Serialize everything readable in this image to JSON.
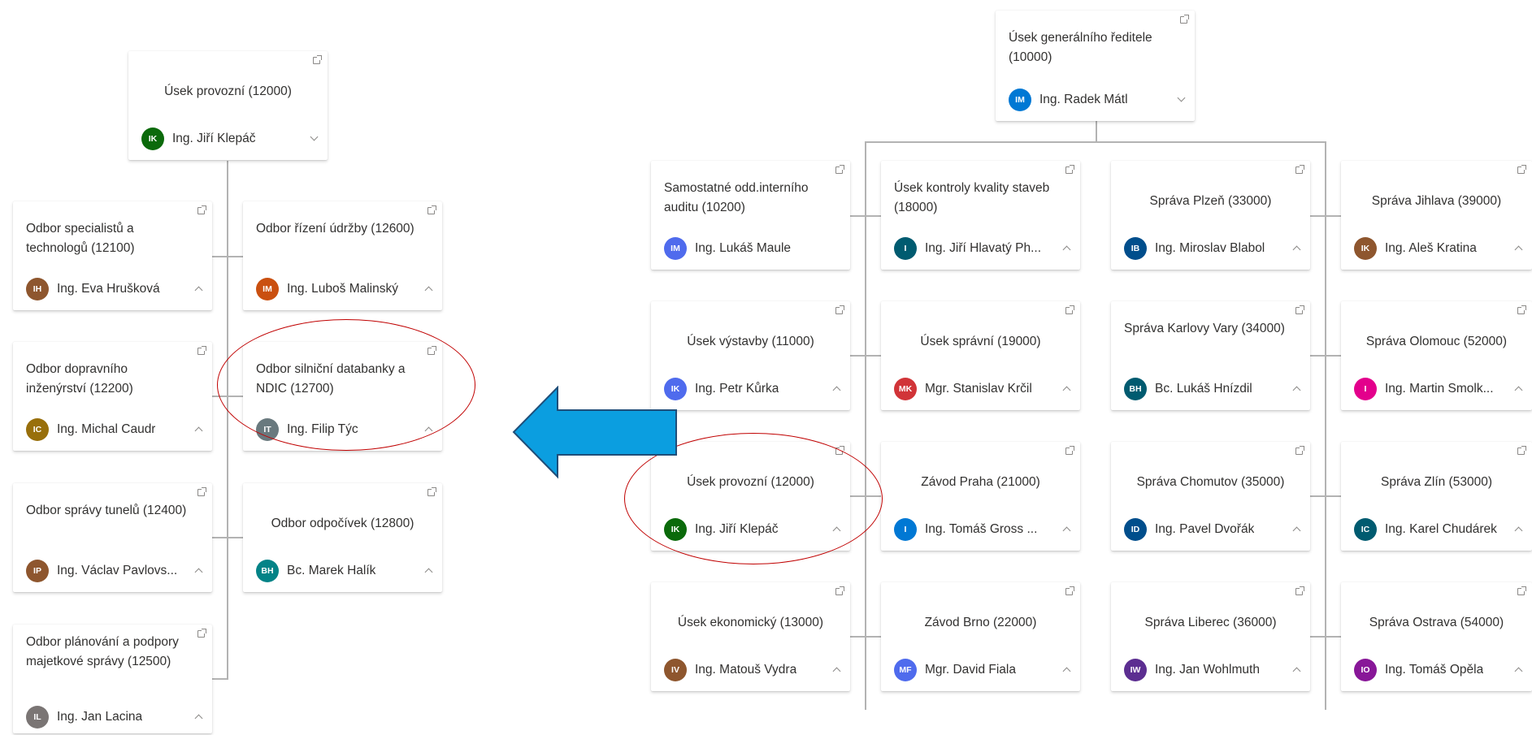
{
  "colors": {
    "connector": "#b3b3b3",
    "highlight_ellipse": "#c00000",
    "arrow_fill": "#0b9ee0",
    "arrow_stroke": "#1f4e79"
  },
  "left_tree": {
    "root": {
      "title": "Úsek provozní (12000)",
      "person": {
        "initials": "IK",
        "name": "Ing. Jiří Klepáč",
        "color": "#0b6a0b"
      },
      "chevron": "down"
    },
    "nodes": [
      {
        "title": "Odbor specialistů a technologů (12100)",
        "person": {
          "initials": "IH",
          "name": "Ing. Eva Hrušková",
          "color": "#8e562e"
        },
        "chevron": "up"
      },
      {
        "title": "Odbor řízení údržby (12600)",
        "person": {
          "initials": "IM",
          "name": "Ing. Luboš Malinský",
          "color": "#ca5010"
        },
        "chevron": "up"
      },
      {
        "title": "Odbor dopravního inženýrství (12200)",
        "person": {
          "initials": "IC",
          "name": "Ing. Michal Caudr",
          "color": "#986f0b"
        },
        "chevron": "up"
      },
      {
        "title": "Odbor silniční databanky a NDIC (12700)",
        "person": {
          "initials": "IT",
          "name": "Ing. Filip Týc",
          "color": "#69797e"
        },
        "chevron": "up"
      },
      {
        "title": "Odbor správy tunelů (12400)",
        "person": {
          "initials": "IP",
          "name": "Ing. Václav Pavlovs...",
          "color": "#8e562e"
        },
        "chevron": "up"
      },
      {
        "title": "Odbor odpočívek (12800)",
        "person": {
          "initials": "BH",
          "name": "Bc. Marek Halík",
          "color": "#038387"
        },
        "chevron": "up"
      },
      {
        "title": "Odbor plánování a podpory majetkové správy (12500)",
        "person": {
          "initials": "IL",
          "name": "Ing. Jan Lacina",
          "color": "#7a7574"
        },
        "chevron": "up"
      }
    ]
  },
  "right_tree": {
    "root": {
      "title": "Úsek generálního ředitele (10000)",
      "person": {
        "initials": "IM",
        "name": "Ing. Radek Mátl",
        "color": "#0078d4"
      },
      "chevron": "down"
    },
    "nodes": [
      {
        "title": "Samostatné odd.interního auditu (10200)",
        "person": {
          "initials": "IM",
          "name": "Ing. Lukáš Maule",
          "color": "#4f6bed"
        },
        "chevron": "none"
      },
      {
        "title": "Úsek kontroly kvality staveb (18000)",
        "person": {
          "initials": "I",
          "name": "Ing. Jiří Hlavatý Ph...",
          "color": "#005b70"
        },
        "chevron": "up"
      },
      {
        "title": "Správa Plzeň (33000)",
        "person": {
          "initials": "IB",
          "name": "Ing. Miroslav Blabol",
          "color": "#004e8c"
        },
        "chevron": "up"
      },
      {
        "title": "Správa Jihlava (39000)",
        "person": {
          "initials": "IK",
          "name": "Ing. Aleš Kratina",
          "color": "#8e562e"
        },
        "chevron": "up"
      },
      {
        "title": "Úsek výstavby (11000)",
        "person": {
          "initials": "IK",
          "name": "Ing. Petr Kůrka",
          "color": "#4f6bed"
        },
        "chevron": "up"
      },
      {
        "title": "Úsek správní (19000)",
        "person": {
          "initials": "MK",
          "name": "Mgr. Stanislav Krčil",
          "color": "#d13438"
        },
        "chevron": "up"
      },
      {
        "title": "Správa Karlovy Vary (34000)",
        "person": {
          "initials": "BH",
          "name": "Bc. Lukáš Hnízdil",
          "color": "#005b70"
        },
        "chevron": "up"
      },
      {
        "title": "Správa Olomouc (52000)",
        "person": {
          "initials": "I",
          "name": "Ing. Martin Smolk...",
          "color": "#e3008c"
        },
        "chevron": "up"
      },
      {
        "title": "Úsek provozní (12000)",
        "person": {
          "initials": "IK",
          "name": "Ing. Jiří Klepáč",
          "color": "#0b6a0b"
        },
        "chevron": "up"
      },
      {
        "title": "Závod Praha (21000)",
        "person": {
          "initials": "I",
          "name": "Ing. Tomáš Gross ...",
          "color": "#0078d4"
        },
        "chevron": "up"
      },
      {
        "title": "Správa Chomutov (35000)",
        "person": {
          "initials": "ID",
          "name": "Ing. Pavel Dvořák",
          "color": "#004e8c"
        },
        "chevron": "up"
      },
      {
        "title": "Správa Zlín (53000)",
        "person": {
          "initials": "IC",
          "name": "Ing. Karel Chudárek",
          "color": "#005b70"
        },
        "chevron": "up"
      },
      {
        "title": "Úsek ekonomický (13000)",
        "person": {
          "initials": "IV",
          "name": "Ing. Matouš Vydra",
          "color": "#8e562e"
        },
        "chevron": "up"
      },
      {
        "title": "Závod Brno (22000)",
        "person": {
          "initials": "MF",
          "name": "Mgr. David Fiala",
          "color": "#4f6bed"
        },
        "chevron": "up"
      },
      {
        "title": "Správa Liberec (36000)",
        "person": {
          "initials": "IW",
          "name": "Ing. Jan Wohlmuth",
          "color": "#5c2e91"
        },
        "chevron": "up"
      },
      {
        "title": "Správa Ostrava (54000)",
        "person": {
          "initials": "IO",
          "name": "Ing. Tomáš Opěla",
          "color": "#881798"
        },
        "chevron": "up"
      }
    ]
  }
}
